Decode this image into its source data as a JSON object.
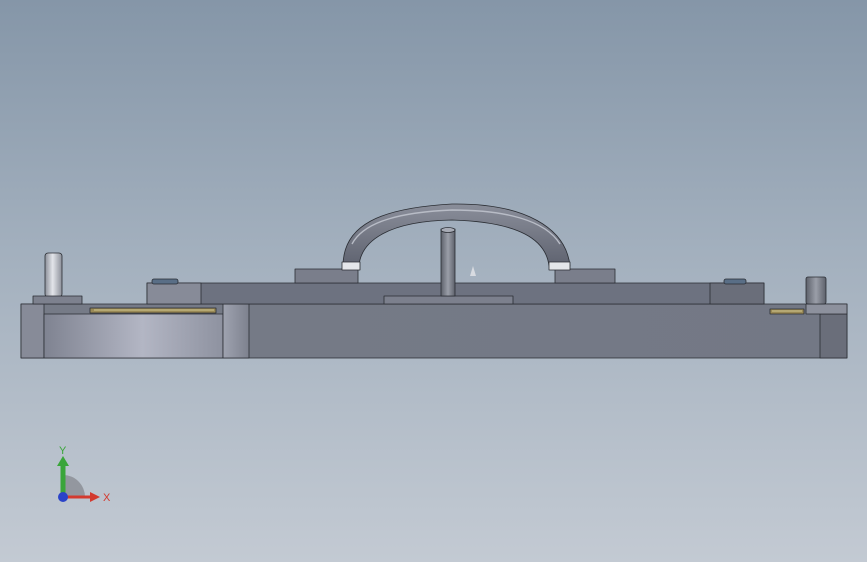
{
  "viewport": {
    "background_top": "#8596a8",
    "background_bottom": "#c3cad3"
  },
  "model": {
    "component": "die-assembly",
    "view": "front",
    "color_body": "#6f7480",
    "color_edges": "#2a2d33"
  },
  "triad": {
    "x_label": "X",
    "y_label": "Y",
    "x_color": "#d33a2f",
    "y_color": "#3aa53a",
    "z_color": "#2a43c8"
  }
}
